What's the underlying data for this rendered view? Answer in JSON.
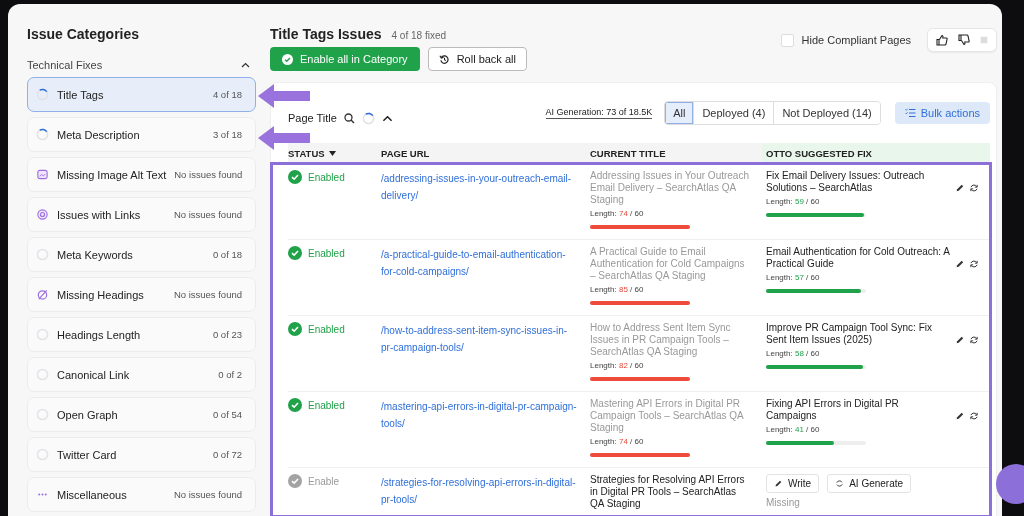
{
  "sidebar": {
    "title": "Issue Categories",
    "section": {
      "label": "Technical Fixes",
      "expanded": true
    },
    "items": [
      {
        "label": "Title Tags",
        "count": "4 of 18",
        "kind": "progress",
        "selected": true
      },
      {
        "label": "Meta Description",
        "count": "3 of 18",
        "kind": "progress",
        "selected": false
      },
      {
        "label": "Missing Image Alt Text",
        "count": "No issues found",
        "kind": "image",
        "selected": false
      },
      {
        "label": "Issues with Links",
        "count": "No issues found",
        "kind": "link",
        "selected": false
      },
      {
        "label": "Meta Keywords",
        "count": "0 of 18",
        "kind": "empty",
        "selected": false
      },
      {
        "label": "Missing Headings",
        "count": "No issues found",
        "kind": "slash",
        "selected": false
      },
      {
        "label": "Headings Length",
        "count": "0 of 23",
        "kind": "empty",
        "selected": false
      },
      {
        "label": "Canonical Link",
        "count": "0 of 2",
        "kind": "empty",
        "selected": false
      },
      {
        "label": "Open Graph",
        "count": "0 of 54",
        "kind": "empty",
        "selected": false
      },
      {
        "label": "Twitter Card",
        "count": "0 of 72",
        "kind": "empty",
        "selected": false
      },
      {
        "label": "Miscellaneous",
        "count": "No issues found",
        "kind": "dots",
        "selected": false
      }
    ]
  },
  "header": {
    "title": "Title Tags Issues",
    "progress": "4 of 18 fixed",
    "enable_button": "Enable all in Category",
    "rollback_button": "Roll back all",
    "hide_compliant": {
      "label": "Hide Compliant Pages",
      "checked": false
    }
  },
  "toolbar": {
    "label": "Page Title",
    "expanded": true,
    "ai_generation": "AI Generation: 73 of 18.5K",
    "filters": [
      {
        "label": "All",
        "selected": true
      },
      {
        "label": "Deployed (4)",
        "selected": false
      },
      {
        "label": "Not Deployed (14)",
        "selected": false
      }
    ],
    "bulk_actions": "Bulk actions"
  },
  "table": {
    "columns": [
      {
        "label": "STATUS",
        "sorted": true
      },
      {
        "label": "PAGE URL",
        "sorted": false
      },
      {
        "label": "CURRENT TITLE",
        "sorted": false
      },
      {
        "label": "OTTO SUGGESTED FIX",
        "sorted": false
      }
    ],
    "rows": [
      {
        "enabled": true,
        "status": "Enabled",
        "url": "/addressing-issues-in-your-outreach-email-delivery/",
        "current": {
          "title": "Addressing Issues in Your Outreach Email Delivery – SearchAtlas QA Staging",
          "length_label": "Length:",
          "value": "74",
          "limit": "/ 60",
          "level": 1,
          "over": true
        },
        "suggested": {
          "kind": "text",
          "title": "Fix Email Delivery Issues: Outreach Solutions – SearchAtlas",
          "length_label": "Length:",
          "value": "59",
          "limit": "/ 60",
          "level": 0.98,
          "over": false
        }
      },
      {
        "enabled": true,
        "status": "Enabled",
        "url": "/a-practical-guide-to-email-authentication-for-cold-campaigns/",
        "current": {
          "title": "A Practical Guide to Email Authentication for Cold Campaigns – SearchAtlas QA Staging",
          "length_label": "Length:",
          "value": "85",
          "limit": "/ 60",
          "level": 1,
          "over": true
        },
        "suggested": {
          "kind": "text",
          "title": "Email Authentication for Cold Outreach: A Practical Guide",
          "length_label": "Length:",
          "value": "57",
          "limit": "/ 60",
          "level": 0.95,
          "over": false
        }
      },
      {
        "enabled": true,
        "status": "Enabled",
        "url": "/how-to-address-sent-item-sync-issues-in-pr-campaign-tools/",
        "current": {
          "title": "How to Address Sent Item Sync Issues in PR Campaign Tools – SearchAtlas QA Staging",
          "length_label": "Length:",
          "value": "82",
          "limit": "/ 60",
          "level": 1,
          "over": true
        },
        "suggested": {
          "kind": "text",
          "title": "Improve PR Campaign Tool Sync: Fix Sent Item Issues (2025)",
          "length_label": "Length:",
          "value": "58",
          "limit": "/ 60",
          "level": 0.97,
          "over": false
        }
      },
      {
        "enabled": true,
        "status": "Enabled",
        "url": "/mastering-api-errors-in-digital-pr-campaign-tools/",
        "current": {
          "title": "Mastering API Errors in Digital PR Campaign Tools – SearchAtlas QA Staging",
          "length_label": "Length:",
          "value": "74",
          "limit": "/ 60",
          "level": 1,
          "over": true
        },
        "suggested": {
          "kind": "text",
          "title": "Fixing API Errors in Digital PR Campaigns",
          "length_label": "Length:",
          "value": "41",
          "limit": "/ 60",
          "level": 0.68,
          "over": false
        }
      },
      {
        "enabled": false,
        "status": "Enable",
        "url": "/strategies-for-resolving-api-errors-in-digital-pr-tools/",
        "current": {
          "title": "Strategies for Resolving API Errors in Digital PR Tools – SearchAtlas QA Staging"
        },
        "suggested": {
          "kind": "missing",
          "write_button": "Write",
          "generate_button": "AI Generate",
          "note": "Missing"
        }
      }
    ]
  }
}
